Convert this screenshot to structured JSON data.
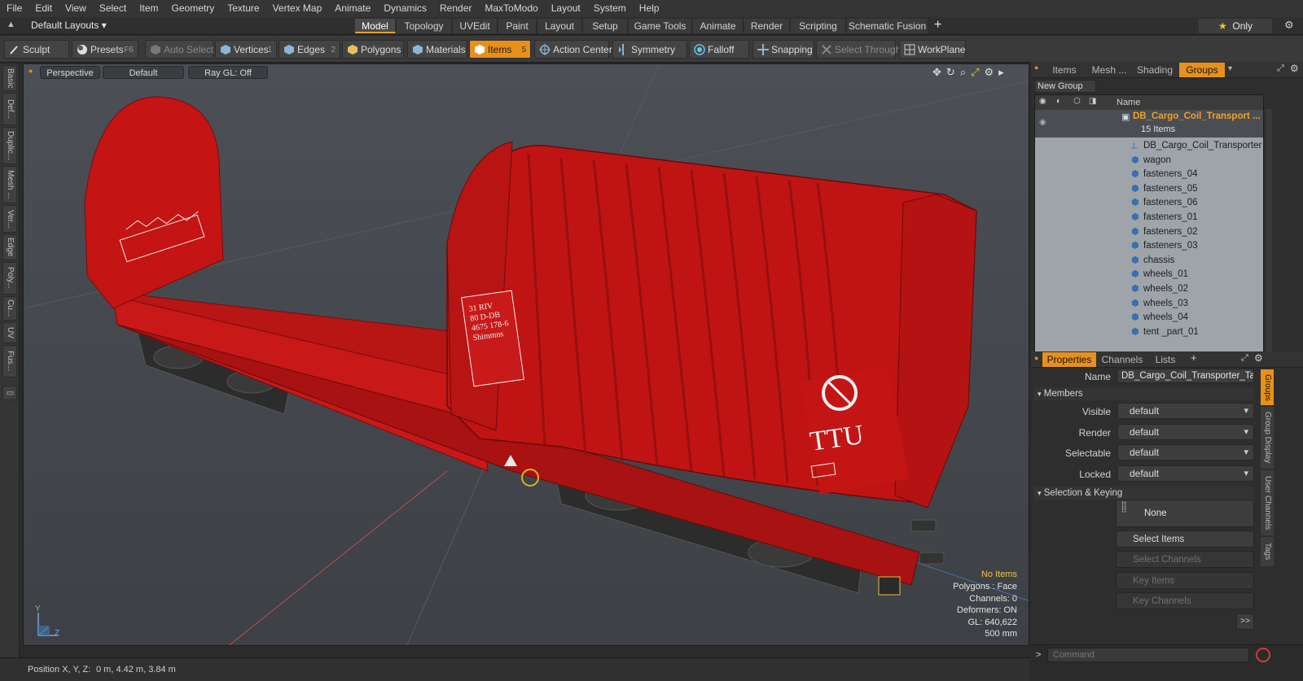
{
  "menu": [
    "File",
    "Edit",
    "View",
    "Select",
    "Item",
    "Geometry",
    "Texture",
    "Vertex Map",
    "Animate",
    "Dynamics",
    "Render",
    "MaxToModo",
    "Layout",
    "System",
    "Help"
  ],
  "layout": {
    "preset": "Default Layouts",
    "tabs": [
      "Model",
      "Topology",
      "UVEdit",
      "Paint",
      "Layout",
      "Setup",
      "Game Tools",
      "Animate",
      "Render",
      "Scripting",
      "Schematic Fusion"
    ],
    "active_tab": "Model",
    "only_label": "Only"
  },
  "toolbar": {
    "sculpt": "Sculpt",
    "presets": "Presets",
    "presets_key": "F6",
    "auto_select": "Auto Select",
    "vertices": "Vertices",
    "vertices_count": "1",
    "edges": "Edges",
    "edges_count": "2",
    "polygons": "Polygons",
    "materials": "Materials",
    "items": "Items",
    "items_count": "5",
    "action_center": "Action Center",
    "symmetry": "Symmetry",
    "falloff": "Falloff",
    "snapping": "Snapping",
    "select_through": "Select Through",
    "workplane": "WorkPlane"
  },
  "left_tabs": [
    "Basic",
    "Def...",
    "Duplic...",
    "Mesh ...",
    "Ver...",
    "Edge",
    "Poly...",
    "Cu...",
    "UV",
    "Fus..."
  ],
  "viewport": {
    "view": "Perspective",
    "shading": "Default",
    "raygl": "Ray GL: Off",
    "hud": {
      "selection": "No Items",
      "polygons": "Polygons : Face",
      "channels": "Channels: 0",
      "deformers": "Deformers: ON",
      "gl": "GL: 640,622",
      "scale": "500 mm"
    },
    "axis_y": "Y",
    "axis_z": "Z",
    "model_text": {
      "ttu": "TTU",
      "plate": [
        "31 RIV",
        "80 D-DB",
        "4675 178-6",
        "Shimmns"
      ]
    }
  },
  "status": {
    "position_label": "Position X, Y, Z:",
    "position_value": "0 m, 4.42 m, 3.84 m"
  },
  "outliner": {
    "tabs": [
      "Items",
      "Mesh ...",
      "Shading",
      "Groups"
    ],
    "active_tab": "Groups",
    "new_group": "New Group",
    "name_col": "Name",
    "group_name": "DB_Cargo_Coil_Transport ...",
    "group_count": "15 Items",
    "items": [
      "DB_Cargo_Coil_Transporter ...",
      "wagon",
      "fasteners_04",
      "fasteners_05",
      "fasteners_06",
      "fasteners_01",
      "fasteners_02",
      "fasteners_03",
      "chassis",
      "wheels_01",
      "wheels_02",
      "wheels_03",
      "wheels_04",
      "tent _part_01"
    ]
  },
  "properties": {
    "tabs": [
      "Properties",
      "Channels",
      "Lists"
    ],
    "active_tab": "Properties",
    "name_label": "Name",
    "name_value": "DB_Cargo_Coil_Transporter_Tarp",
    "members_section": "Members",
    "fields": [
      {
        "label": "Visible",
        "value": "default"
      },
      {
        "label": "Render",
        "value": "default"
      },
      {
        "label": "Selectable",
        "value": "default"
      },
      {
        "label": "Locked",
        "value": "default"
      }
    ],
    "selection_section": "Selection & Keying",
    "none_label": "None",
    "select_items": "Select Items",
    "select_channels": "Select Channels",
    "key_items": "Key Items",
    "key_channels": "Key Channels",
    "more": ">>",
    "side_tabs": [
      "Groups",
      "Group Display",
      "User Channels",
      "Tags"
    ]
  },
  "command": {
    "placeholder": "Command"
  },
  "colors": {
    "accent": "#e8901c",
    "model_red": "#c41414",
    "selected_group": "#f2a12a"
  }
}
